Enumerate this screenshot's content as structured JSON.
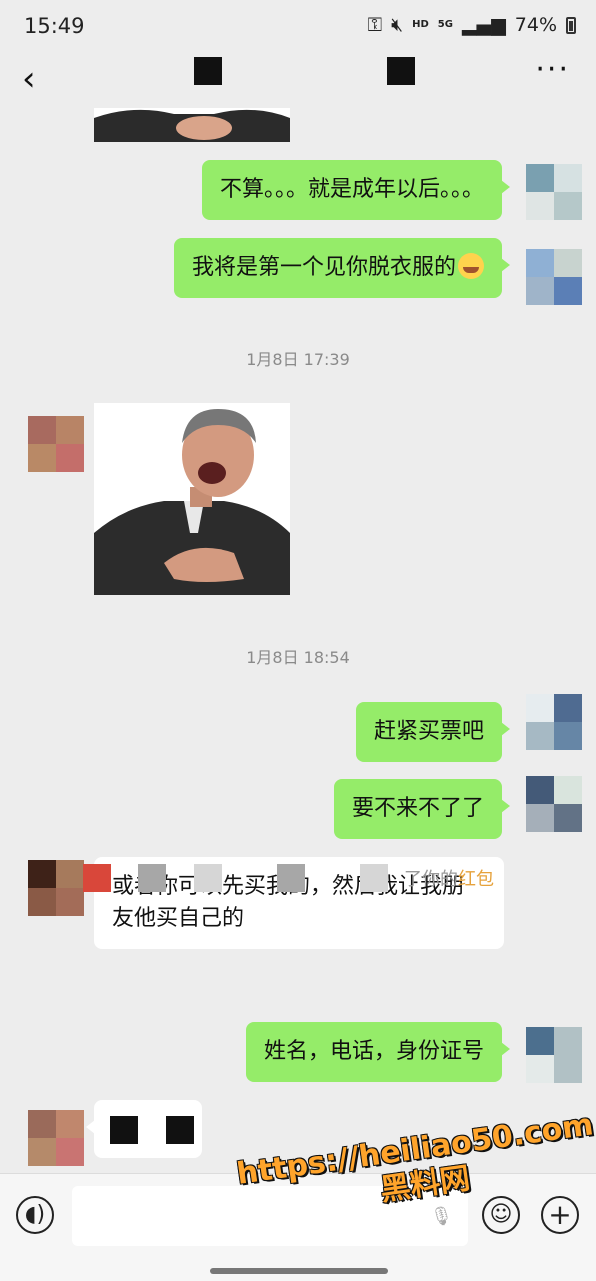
{
  "status_bar": {
    "time": "15:49",
    "indicators": [
      "key-icon",
      "mute-icon",
      "HD",
      "5G",
      "signal-icon"
    ],
    "network_hd": "HD",
    "network_5g": "5G",
    "battery_percent": "74%"
  },
  "header": {
    "back_icon": "chevron-left-icon",
    "more_icon": "more-dots-icon"
  },
  "messages": [
    {
      "id": "m1",
      "side": "right",
      "text": "不算。。。就是成年以后。。。"
    },
    {
      "id": "m2",
      "side": "right",
      "text": "我将是第一个见你脱衣服的",
      "emoji": "crying-laughing-emoji"
    },
    {
      "id": "ts1",
      "type": "timestamp",
      "text": "1月8日 17:39"
    },
    {
      "id": "m3",
      "side": "left",
      "type": "sticker",
      "sticker_icon": "man-laughing-sticker"
    },
    {
      "id": "ts2",
      "type": "timestamp",
      "text": "1月8日 18:54"
    },
    {
      "id": "m4",
      "side": "right",
      "text": "赶紧买票吧"
    },
    {
      "id": "m5",
      "side": "right",
      "text": "要不来不了了"
    },
    {
      "id": "m6",
      "side": "left",
      "line1": "或者你可以先买我的，然后我让我朋",
      "line2": "友他买自己的"
    },
    {
      "id": "m7",
      "side": "right",
      "text": "姓名，电话，身份证号"
    }
  ],
  "system_notice": {
    "prefix": "了你的",
    "highlight": "红包"
  },
  "watermark": {
    "line1": "https://heiliao50.com",
    "line2": "黑料网"
  },
  "input_bar": {
    "voice_icon": "voice-icon",
    "emoji_icon": "smiley-icon",
    "plus_icon": "plus-icon",
    "mic_icon": "mic-icon",
    "placeholder": ""
  },
  "colors": {
    "background": "#ededed",
    "sent_bubble": "#95ec69",
    "received_bubble": "#ffffff",
    "timestamp_text": "#8a8a8a",
    "red_packet_text": "#e6a23c",
    "watermark": "#ffa42b"
  }
}
